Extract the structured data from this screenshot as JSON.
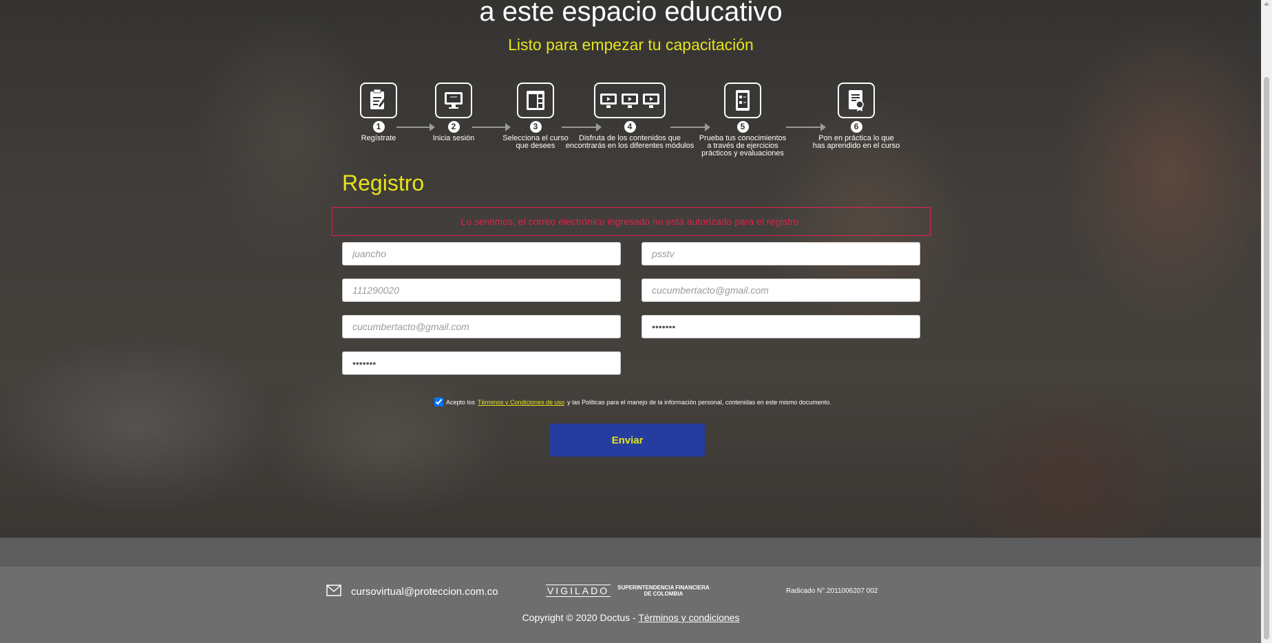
{
  "hero": {
    "title": "a este espacio educativo",
    "subtitle": "Listo para empezar tu capacitación"
  },
  "steps": [
    {
      "num": "1",
      "label": "Regístrate",
      "icon": "clipboard-pen-icon"
    },
    {
      "num": "2",
      "label": "Inicia sesión",
      "icon": "monitor-icon"
    },
    {
      "num": "3",
      "label": "Selecciona el curso\nque desees",
      "icon": "layout-icon"
    },
    {
      "num": "4",
      "label": "Disfruta de los contenidos que\nencontrarás en los diferentes módulos",
      "icon": "three-monitors-icon"
    },
    {
      "num": "5",
      "label": "Prueba tus conocimientos\na través de ejercicios\nprácticos y evaluaciones",
      "icon": "checklist-icon"
    },
    {
      "num": "6",
      "label": "Pon en práctica lo que\nhas aprendido en el curso",
      "icon": "certificate-icon"
    }
  ],
  "form": {
    "title": "Registro",
    "error": "Lo sentimos, el correo electrónico ingresado no está autorizado para el registro.",
    "fields": {
      "nombre": {
        "value": "",
        "placeholder": "juancho"
      },
      "apellido": {
        "value": "",
        "placeholder": "psstv"
      },
      "documento": {
        "value": "",
        "placeholder": "111290020"
      },
      "correo": {
        "value": "",
        "placeholder": "cucumbertacto@gmail.com"
      },
      "confirmar_correo": {
        "value": "",
        "placeholder": "cucumbertacto@gmail.com"
      },
      "password": {
        "value": "•••••••",
        "placeholder": ""
      },
      "confirmar_password": {
        "value": "•••••••",
        "placeholder": ""
      }
    },
    "terms": {
      "checked": true,
      "prefix": "Acepto los",
      "link": "Términos y Condiciones de uso",
      "suffix": "y las Politicas para el manejo de la información personal, contenidas en este mismo documento."
    },
    "submit_label": "Enviar"
  },
  "footer": {
    "email": "cursovirtual@proteccion.com.co",
    "vigilado": "VIGILADO",
    "superintendencia": "SUPERINTENDENCIA FINANCIERA\nDE COLOMBIA",
    "radicado": "Radicado N°.2011006207 002",
    "copyright": "Copyright © 2020 Doctus -",
    "terms_link": "Términos y condiciones"
  },
  "colors": {
    "accent": "#e7e41b",
    "button": "#243d9e",
    "error": "#e0224b"
  }
}
